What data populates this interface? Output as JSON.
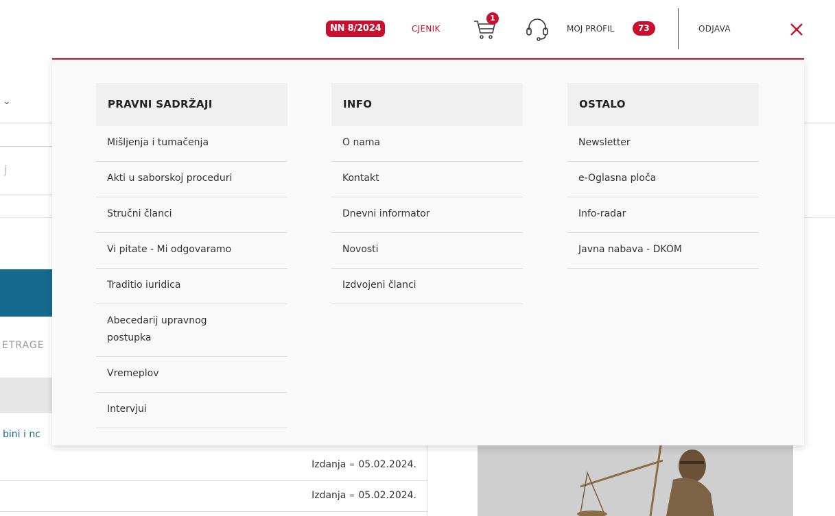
{
  "header": {
    "nn_issue": "NN 8/2024",
    "cjenik": "CJENIK",
    "cart_count": "1",
    "profile_label": "MOJ PROFIL",
    "profile_count": "73",
    "logout": "ODJAVA"
  },
  "menu": {
    "columns": [
      {
        "title": "PRAVNI SADRŽAJI",
        "items": [
          "Mišljenja i tumačenja",
          "Akti u saborskoj proceduri",
          "Stručni članci",
          "Vi pitate - Mi odgovaramo",
          "Traditio iuridica",
          "Abecedarij upravnog postupka",
          "Vremeplov",
          "Intervjui"
        ]
      },
      {
        "title": "INFO",
        "items": [
          "O nama",
          "Kontakt",
          "Dnevni informator",
          "Novosti",
          "Izdvojeni članci"
        ]
      },
      {
        "title": "OSTALO",
        "items": [
          "Newsletter",
          "e-Oglasna ploča",
          "Info-radar",
          "Javna nabava - DKOM"
        ]
      }
    ]
  },
  "background": {
    "search_fragment": "j",
    "pretrage_fragment": "ETRAGE",
    "link_fragment": "bini i nc",
    "rows": [
      {
        "type": "Izdanja",
        "date": "05.02.2024."
      },
      {
        "type": "Izdanja",
        "date": "05.02.2024."
      }
    ]
  },
  "colors": {
    "accent": "#c8102e",
    "link_blue": "#166a8e"
  },
  "icons": [
    "shopping-cart-icon",
    "headset-icon",
    "close-icon",
    "chevron-down-icon"
  ]
}
